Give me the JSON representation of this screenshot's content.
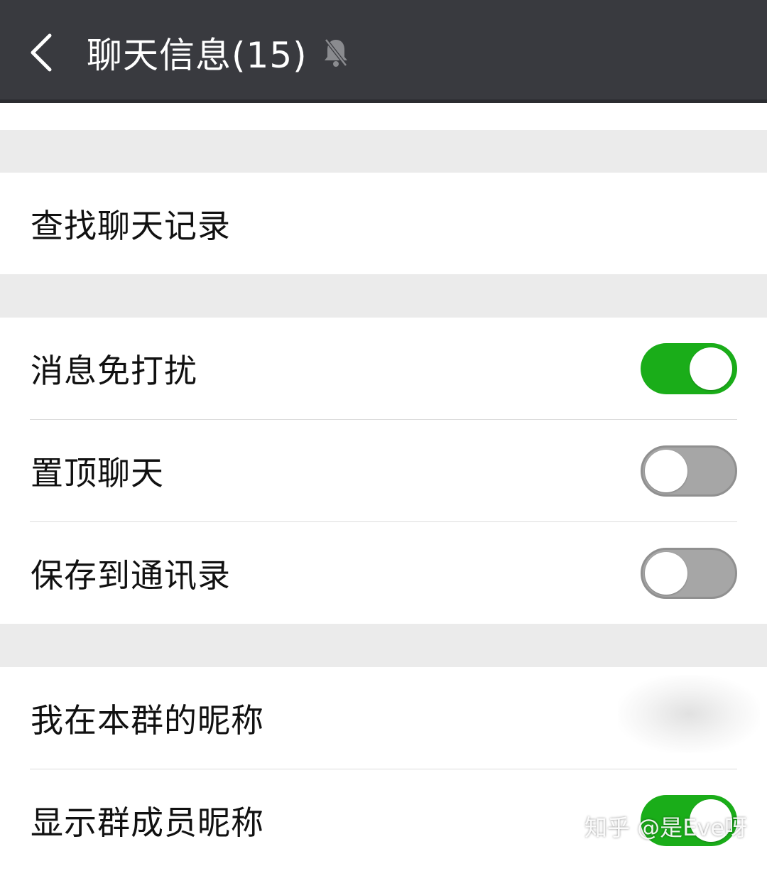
{
  "header": {
    "title": "聊天信息(15)",
    "back_icon": "chevron-left-icon",
    "mute_icon": "bell-off-icon"
  },
  "sections": [
    {
      "rows": [
        {
          "label": "查找聊天记录"
        }
      ]
    },
    {
      "rows": [
        {
          "label": "消息免打扰",
          "toggle": "on"
        },
        {
          "label": "置顶聊天",
          "toggle": "off"
        },
        {
          "label": "保存到通讯录",
          "toggle": "off"
        }
      ]
    },
    {
      "rows": [
        {
          "label": "我在本群的昵称"
        },
        {
          "label": "显示群成员昵称",
          "toggle": "on"
        }
      ]
    }
  ],
  "watermark": "知乎 @是Eve呀",
  "colors": {
    "header_bg": "#393a3f",
    "toggle_on": "#1aad19",
    "toggle_off": "#a6a6a6",
    "page_bg": "#ebebeb"
  }
}
